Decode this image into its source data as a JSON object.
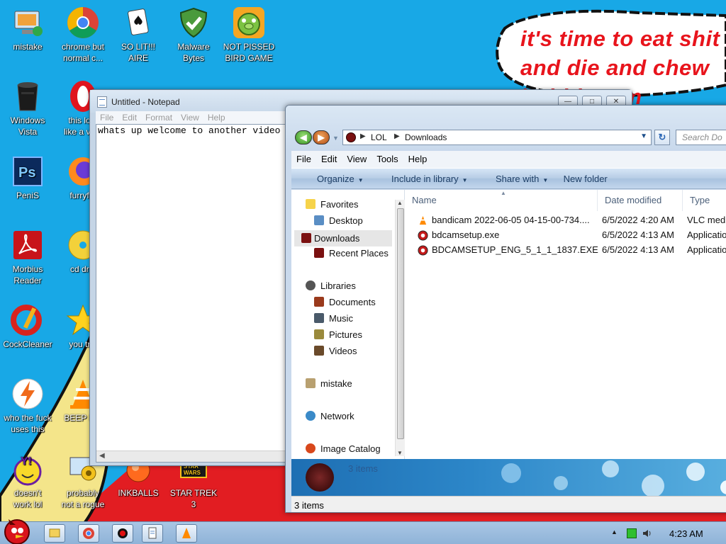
{
  "wallpaper": {
    "bubble_text": "it's time to eat shit\nand die and chew\nbubblegum"
  },
  "desktop_icons": [
    {
      "label": "mistake",
      "icon": "computer-icon"
    },
    {
      "label": "chrome but\nnormal c...",
      "icon": "chrome-icon"
    },
    {
      "label": "SO LIT!!!\nAIRE",
      "icon": "solitaire-icon"
    },
    {
      "label": "Malware\nBytes",
      "icon": "shield-icon"
    },
    {
      "label": "NOT PISSED\nBIRD GAME",
      "icon": "pig-icon"
    },
    {
      "label": "Windows\nVista",
      "icon": "recycle-bin-icon"
    },
    {
      "label": "this lo...\nlike a va...",
      "icon": "opera-icon"
    },
    {
      "label": "PeniS",
      "icon": "photoshop-icon"
    },
    {
      "label": "furryf...",
      "icon": "firefox-icon"
    },
    {
      "label": "Morbius\nReader",
      "icon": "acrobat-icon"
    },
    {
      "label": "cd dr...",
      "icon": "cd-icon"
    },
    {
      "label": "CockCleaner",
      "icon": "ccleaner-icon"
    },
    {
      "label": "you tr...",
      "icon": "star-icon"
    },
    {
      "label": "who the fuck\nuses this",
      "icon": "lightning-icon"
    },
    {
      "label": "BEEP B...",
      "icon": "vlc-icon"
    },
    {
      "label": "doesn't\nwork lol",
      "icon": "yahoo-icon"
    },
    {
      "label": "probably\nnot a rogue",
      "icon": "settings-icon"
    },
    {
      "label": "INKBALLS",
      "icon": "inkball-icon"
    },
    {
      "label": "STAR TREK\n3",
      "icon": "star-wars-icon"
    }
  ],
  "notepad": {
    "title": "Untitled - Notepad",
    "menu": [
      "File",
      "Edit",
      "Format",
      "View",
      "Help"
    ],
    "content": "whats up welcome to another video"
  },
  "explorer": {
    "breadcrumb": [
      "LOL",
      "Downloads"
    ],
    "search_placeholder": "Search Do",
    "menu": [
      "File",
      "Edit",
      "View",
      "Tools",
      "Help"
    ],
    "commands": [
      "Organize",
      "Include in library",
      "Share with",
      "New folder"
    ],
    "nav": {
      "favorites": "Favorites",
      "desktop": "Desktop",
      "downloads": "Downloads",
      "recent": "Recent Places",
      "libraries": "Libraries",
      "documents": "Documents",
      "music": "Music",
      "pictures": "Pictures",
      "videos": "Videos",
      "mistake": "mistake",
      "network": "Network",
      "image_catalog": "Image Catalog"
    },
    "columns": [
      "Name",
      "Date modified",
      "Type"
    ],
    "files": [
      {
        "name": "bandicam 2022-06-05 04-15-00-734....",
        "date": "6/5/2022 4:20 AM",
        "type": "VLC medi"
      },
      {
        "name": "bdcamsetup.exe",
        "date": "6/5/2022 4:13 AM",
        "type": "Applicatio"
      },
      {
        "name": "BDCAMSETUP_ENG_5_1_1_1837.EXE",
        "date": "6/5/2022 4:13 AM",
        "type": "Applicatio"
      }
    ],
    "details_count": "3 items",
    "status": "3 items"
  },
  "taskbar": {
    "clock": "4:23 AM"
  },
  "colors": {
    "desktop": "#18a8e6",
    "bubble_text": "#e8141c"
  }
}
